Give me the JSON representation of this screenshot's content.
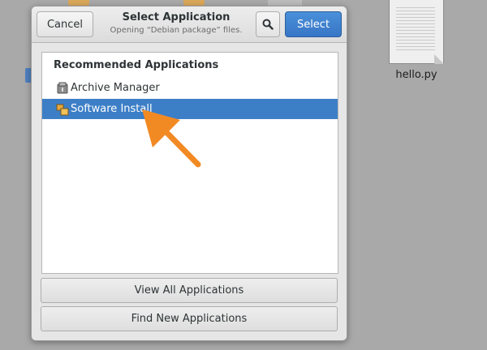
{
  "background": {
    "file_label": "hello.py"
  },
  "dialog": {
    "title": "Select Application",
    "subtitle": "Opening “Debian package” files.",
    "cancel_label": "Cancel",
    "select_label": "Select",
    "list_heading": "Recommended Applications",
    "apps": [
      {
        "name": "Archive Manager",
        "icon": "archive-manager-icon",
        "selected": false
      },
      {
        "name": "Software Install",
        "icon": "software-install-icon",
        "selected": true
      }
    ],
    "view_all_label": "View All Applications",
    "find_new_label": "Find New Applications"
  },
  "colors": {
    "selection": "#3d7fc7",
    "select_button": "#3875c6",
    "annotation_arrow": "#f28a24"
  }
}
